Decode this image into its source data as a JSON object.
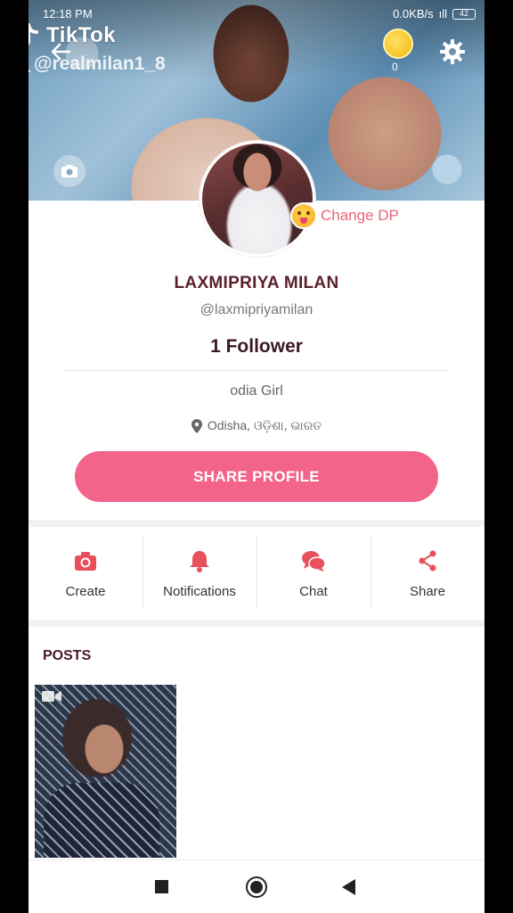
{
  "status_bar": {
    "time": "12:18 PM",
    "network_speed": "0.0KB/s",
    "signal": "ıll",
    "battery": "42"
  },
  "watermark": {
    "app": "TikTok",
    "handle": "@realmilan1_8"
  },
  "header": {
    "coins": "0"
  },
  "profile": {
    "change_dp_label": "Change DP",
    "name": "LAXMIPRIYA MILAN",
    "username": "@laxmipriyamilan",
    "followers": "1 Follower",
    "bio": "odia Girl",
    "location": "Odisha, ଓଡ଼ିଶା, ଭାରତ",
    "share_button": "SHARE PROFILE"
  },
  "actions": [
    {
      "label": "Create",
      "icon": "camera-icon"
    },
    {
      "label": "Notifications",
      "icon": "bell-icon"
    },
    {
      "label": "Chat",
      "icon": "chat-bubbles-icon"
    },
    {
      "label": "Share",
      "icon": "share-icon"
    }
  ],
  "posts": {
    "title": "POSTS"
  },
  "colors": {
    "accent": "#f26489",
    "action_icon": "#e8505b",
    "name_text": "#5a1f2b"
  }
}
